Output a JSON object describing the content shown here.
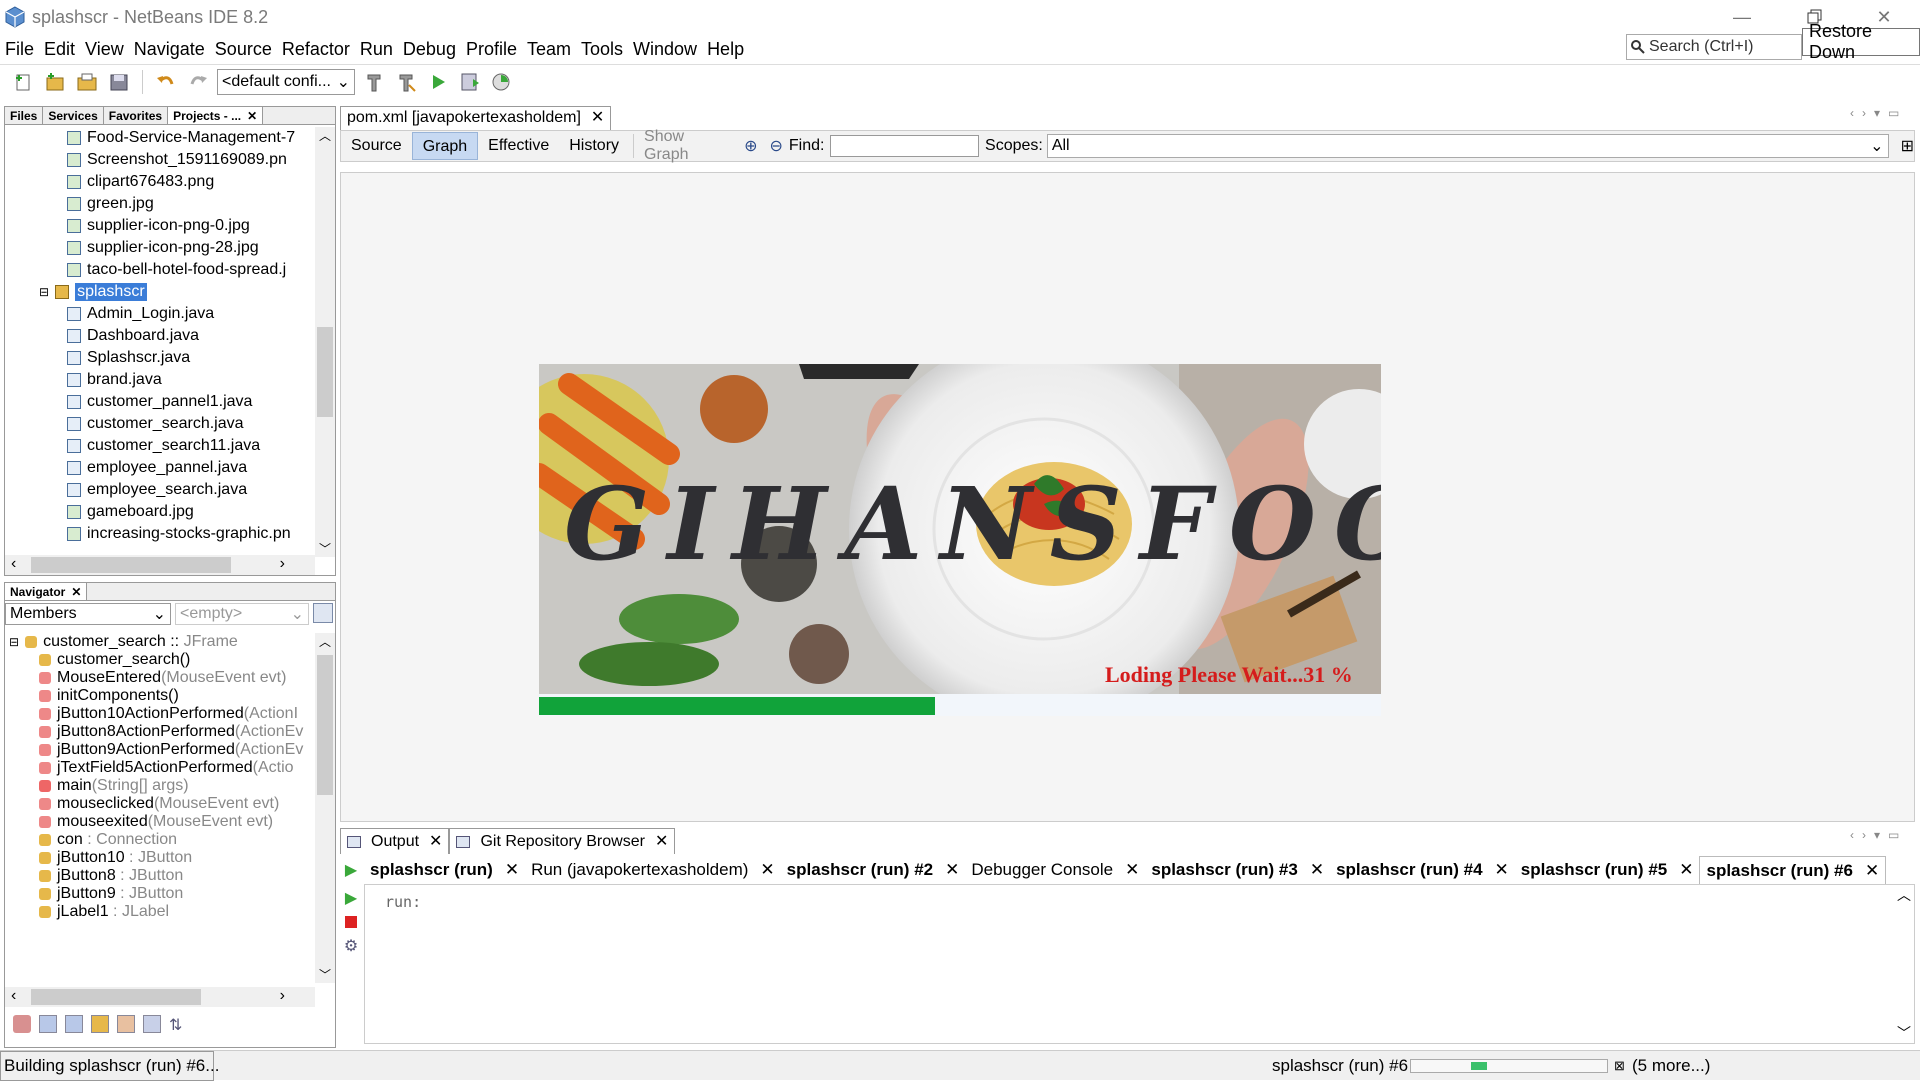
{
  "window": {
    "title": "splashscr - NetBeans IDE 8.2",
    "tooltip": "Restore Down",
    "search_placeholder": "Search (Ctrl+I)"
  },
  "menu": [
    "File",
    "Edit",
    "View",
    "Navigate",
    "Source",
    "Refactor",
    "Run",
    "Debug",
    "Profile",
    "Team",
    "Tools",
    "Window",
    "Help"
  ],
  "toolbar": {
    "config": "<default confi..."
  },
  "projects_panel": {
    "tabs": [
      "Files",
      "Services",
      "Favorites",
      "Projects - ..."
    ],
    "items": [
      "Food-Service-Management-7",
      "Screenshot_1591169089.pn",
      "clipart676483.png",
      "green.jpg",
      "supplier-icon-png-0.jpg",
      "supplier-icon-png-28.jpg",
      "taco-bell-hotel-food-spread.j",
      "splashscr",
      "Admin_Login.java",
      "Dashboard.java",
      "Splashscr.java",
      "brand.java",
      "customer_pannel1.java",
      "customer_search.java",
      "customer_search11.java",
      "employee_pannel.java",
      "employee_search.java",
      "gameboard.jpg",
      "increasing-stocks-graphic.pn"
    ]
  },
  "navigator": {
    "tab": "Navigator",
    "filter": "Members",
    "empty_select": "<empty>",
    "root": {
      "name": "customer_search",
      "sep": " :: ",
      "type": "JFrame"
    },
    "members": [
      {
        "name": "customer_search()",
        "type": ""
      },
      {
        "name": "MouseEntered",
        "type": "(MouseEvent evt)"
      },
      {
        "name": "initComponents()",
        "type": ""
      },
      {
        "name": "jButton10ActionPerformed",
        "type": "(ActionI"
      },
      {
        "name": "jButton8ActionPerformed",
        "type": "(ActionEv"
      },
      {
        "name": "jButton9ActionPerformed",
        "type": "(ActionEv"
      },
      {
        "name": "jTextField5ActionPerformed",
        "type": "(Actio"
      },
      {
        "name": "main",
        "type": "(String[] args)"
      },
      {
        "name": "mouseclicked",
        "type": "(MouseEvent evt)"
      },
      {
        "name": "mouseexited",
        "type": "(MouseEvent evt)"
      },
      {
        "name": "con",
        "type": " : Connection"
      },
      {
        "name": "jButton10",
        "type": " : JButton"
      },
      {
        "name": "jButton8",
        "type": " : JButton"
      },
      {
        "name": "jButton9",
        "type": " : JButton"
      },
      {
        "name": "jLabel1",
        "type": " : JLabel"
      }
    ]
  },
  "editor": {
    "tab": "pom.xml [javapokertexasholdem]",
    "buttons": [
      "Source",
      "Graph",
      "Effective",
      "History"
    ],
    "active_button": "Graph",
    "show_graph": "Show Graph",
    "find_label": "Find:",
    "scopes_label": "Scopes:",
    "scopes_value": "All"
  },
  "splash": {
    "brand": "GIHANSFOOD",
    "loading_text": "Loding Please Wait...31 %",
    "progress": 0.47
  },
  "output": {
    "tabs": [
      "Output",
      "Git Repository Browser"
    ],
    "subtabs": [
      {
        "label": "splashscr (run)",
        "bold": true
      },
      {
        "label": "Run (javapokertexasholdem)",
        "bold": false
      },
      {
        "label": "splashscr (run) #2",
        "bold": true
      },
      {
        "label": "Debugger Console",
        "bold": false
      },
      {
        "label": "splashscr (run) #3",
        "bold": true
      },
      {
        "label": "splashscr (run) #4",
        "bold": true
      },
      {
        "label": "splashscr (run) #5",
        "bold": true
      },
      {
        "label": "splashscr (run) #6",
        "bold": true
      }
    ],
    "text": "run:"
  },
  "status": {
    "left": "Building splashscr (run) #6...",
    "task": "splashscr (run) #6",
    "more": "(5 more...)"
  }
}
